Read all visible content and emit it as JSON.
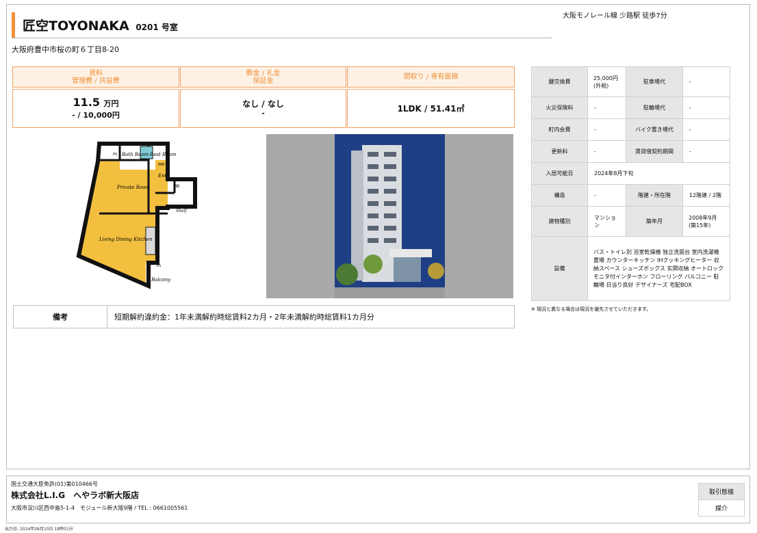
{
  "header": {
    "building_name": "匠空TOYONAKA",
    "room": "0201 号室",
    "access": "大阪モノレール線 少路駅 徒歩7分",
    "address": "大阪府豊中市桜の町６丁目8-20"
  },
  "summary": {
    "rent_label": "賃料",
    "fees_label": "管理費 / 共益費",
    "rent_value": "11.5",
    "rent_unit": "万円",
    "fees_value": "- / 10,000円",
    "deposit_label": "敷金 / 礼金",
    "guarantee_label": "保証金",
    "deposit_value": "なし / なし",
    "guarantee_value": "-",
    "layout_label": "間取り / 専有面積",
    "layout_value": "1LDK / 51.41㎡"
  },
  "floorplan": {
    "labels": [
      "Bath Room",
      "Rest Room",
      "Ent",
      "Private Room",
      "MB",
      "Shelf",
      "Living Dining Kitchen",
      "Balcony",
      "PS",
      "WM",
      "PS"
    ],
    "wall_color": "#111111",
    "floor_color": "#f2bf3f"
  },
  "remarks": {
    "label": "備考",
    "text": "短期解約違約金：1年未満解約時総賃料2カ月・2年未満解約時総賃料1カ月分"
  },
  "specs": {
    "key_exchange_label": "鍵交換費",
    "key_exchange_value_1": "25,000円",
    "key_exchange_value_2": "(外税)",
    "parking_label": "駐車場代",
    "parking_value": "-",
    "fire_insurance_label": "火災保険料",
    "fire_insurance_value": "-",
    "bicycle_label": "駐輪場代",
    "bicycle_value": "-",
    "community_fee_label": "町内会費",
    "community_fee_value": "-",
    "bike_parking_label": "バイク置き場代",
    "bike_parking_value": "-",
    "renewal_label": "更新料",
    "renewal_value": "-",
    "lease_term_label": "賃貸借契約期間",
    "lease_term_value": "-",
    "move_in_label": "入居可能日",
    "move_in_value": "2024年8月下旬",
    "structure_label": "構造",
    "structure_value": "-",
    "floors_label": "階建・所在階",
    "floors_value": "12階建 / 2階",
    "building_type_label": "建物種別",
    "building_type_value_1": "マンショ",
    "building_type_value_2": "ン",
    "built_label": "築年月",
    "built_value_1": "2008年9月",
    "built_value_2": "(築15年)",
    "facilities_label": "設備",
    "facilities_value": "バス・トイレ別 浴室乾燥機 独立洗面台 室内洗濯機置場 カウンターキッチン IHクッキングヒーター 収納スペース シューズボックス 玄関収納 オートロック モニタ付インターホン フローリング バルコニー 駐輪場 日当り良好 デザイナーズ 宅配BOX",
    "note": "※ 現況と異なる場合は現況を優先させていただきます。"
  },
  "footer": {
    "license": "国土交通大臣免許(01)第010466号",
    "company": "株式会社L.I.G　へやラボ新大阪店",
    "company_address": "大阪市淀川区西中島5-1-4　モジュール新大阪9階 / TEL : 0661005561",
    "deal_type_label": "取引態様",
    "deal_type_value": "媒介",
    "printed_at": "出力日: 2024年08月10日 18時01分"
  },
  "colors": {
    "accent": "#f0913a",
    "accent_light": "#fdf1e4",
    "label_gray": "#e6e6e6",
    "sky": "#1f3f85"
  },
  "photo": {
    "alt": "building-exterior-photo"
  }
}
